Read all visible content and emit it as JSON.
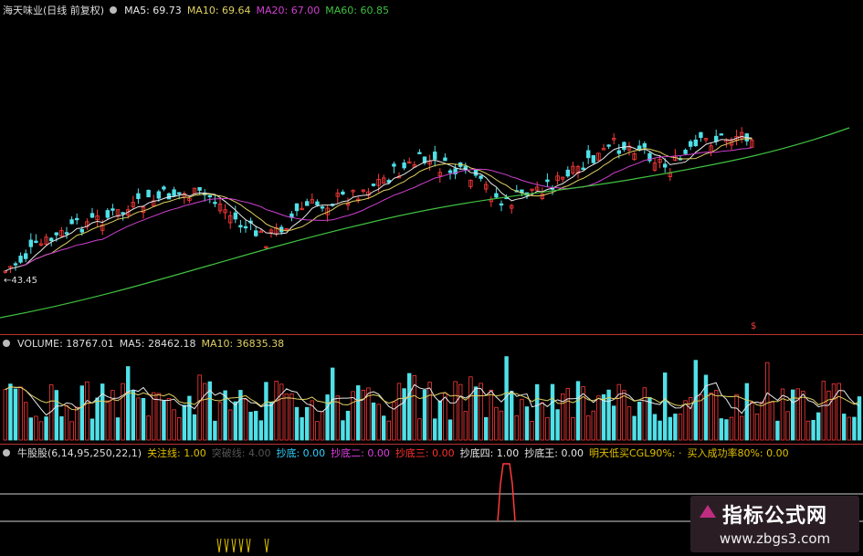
{
  "price_panel": {
    "stock_name": "海天味业(日线 前复权)",
    "ma5": "MA5: 69.73",
    "ma10": "MA10: 69.64",
    "ma20": "MA20: 67.00",
    "ma60": "MA60: 60.85",
    "low_marker": "←43.45",
    "colors": {
      "ma5": "#e8e8e8",
      "ma10": "#e0d060",
      "ma20": "#d040d0",
      "ma60": "#40c040"
    }
  },
  "volume_panel": {
    "volume": "VOLUME: 18767.01",
    "ma5": "MA5: 28462.18",
    "ma10": "MA10: 36835.38"
  },
  "indicator_panel": {
    "name": "牛股股(6,14,95,250,22,1)",
    "items": [
      {
        "label": "关注线: 1.00",
        "color": "#e0c000"
      },
      {
        "label": "突破线: 4.00",
        "color": "#555555"
      },
      {
        "label": "抄底: 0.00",
        "color": "#30d0ff"
      },
      {
        "label": "抄底二: 0.00",
        "color": "#e040e0"
      },
      {
        "label": "抄底三: 0.00",
        "color": "#ff3030"
      },
      {
        "label": "抄底四: 1.00",
        "color": "#e8e8e8"
      },
      {
        "label": "抄底王: 0.00",
        "color": "#e8e8e8"
      },
      {
        "label": "明天低买CGL90%: ·",
        "color": "#e0c000"
      },
      {
        "label": "买入成功率80%: 0.00",
        "color": "#e0c000"
      }
    ]
  },
  "watermark": {
    "title": "指标公式网",
    "url": "www.zbgs3.com"
  },
  "candle_colors": {
    "up": "#ff3a3a",
    "down": "#50e0e8"
  }
}
